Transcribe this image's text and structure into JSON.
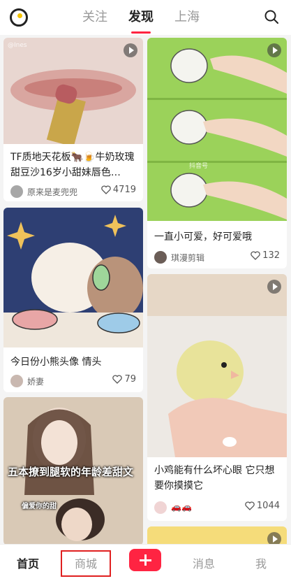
{
  "header": {
    "tabs": [
      {
        "label": "关注",
        "active": false
      },
      {
        "label": "发现",
        "active": true
      },
      {
        "label": "上海",
        "active": false
      }
    ],
    "search_icon": "search-icon",
    "logo_icon": "app-logo"
  },
  "feed": {
    "cards": [
      {
        "title": "TF质地天花板🐂🍺牛奶玫瑰甜豆沙16岁小甜妹唇色…",
        "author": "原来是麦兜兜",
        "likes": "4719",
        "is_video": true,
        "image_watermark": "@Ines"
      },
      {
        "title": "一直小可爱，好可爱哦",
        "author": "琪漫剪辑",
        "likes": "132",
        "is_video": true,
        "image_watermark": "抖音号"
      },
      {
        "title": "今日份小熊头像 情头",
        "author": "娇妻",
        "likes": "79",
        "is_video": false
      },
      {
        "title": "小鸡能有什么坏心眼 它只想要你摸摸它",
        "author": "🚗🚗",
        "likes": "1044",
        "is_video": true
      },
      {
        "title": "",
        "author": "",
        "likes": "",
        "is_video": false,
        "image_caption": "五本撩到腿软的年龄差甜文",
        "image_sub": "偏爱你的甜"
      },
      {
        "title": "",
        "author": "",
        "likes": "",
        "is_video": true
      }
    ]
  },
  "bottom_nav": {
    "home": "首页",
    "shop": "商城",
    "add_icon": "plus-icon",
    "messages": "消息",
    "me": "我"
  },
  "colors": {
    "accent": "#ff2442",
    "highlight_box": "#e02020"
  }
}
